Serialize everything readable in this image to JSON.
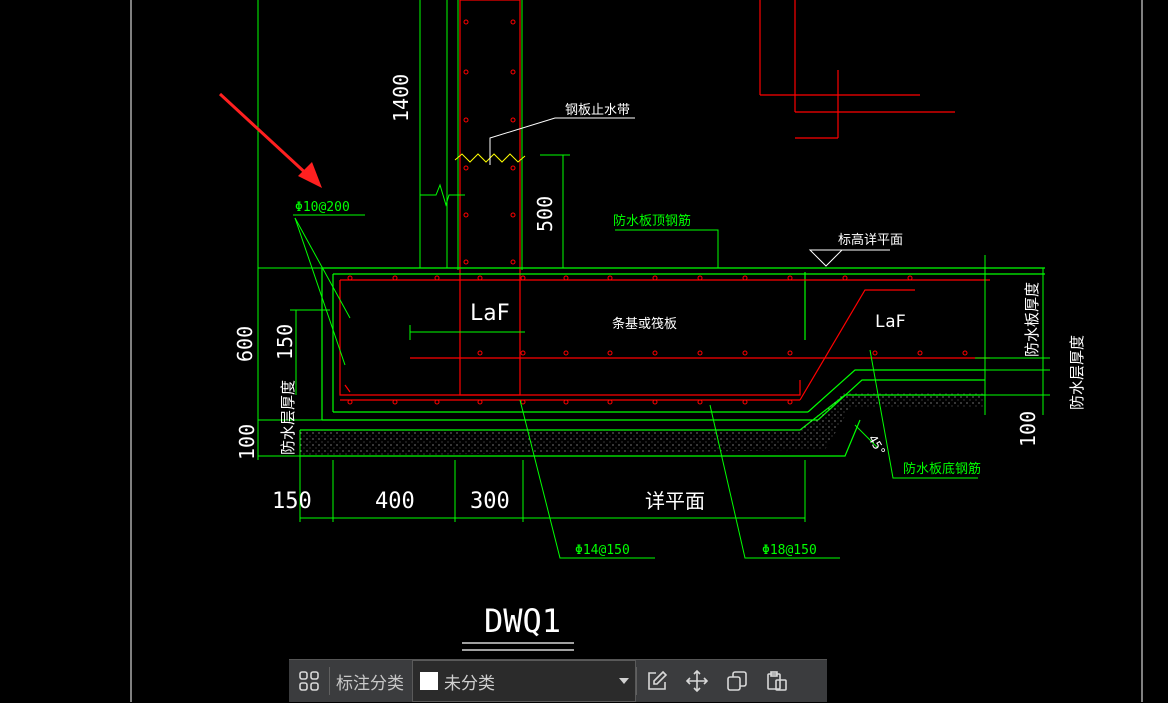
{
  "drawing": {
    "title": "DWQ1",
    "labels": {
      "rebar_top_left": "Φ10@200",
      "steel_waterstop": "钢板止水带",
      "waterproof_top_rebar": "防水板顶钢筋",
      "elevation_ref": "标高详平面",
      "laf_left": "LaF",
      "laf_right": "LaF",
      "strip_base": "条基或筏板",
      "waterproof_thickness_right": "防水板厚度",
      "waterproof_layer_right": "防水层厚度",
      "waterproof_layer_left": "防水层厚度",
      "waterproof_bottom_rebar": "防水板底钢筋",
      "rebar_14": "Φ14@150",
      "rebar_18": "Φ18@150",
      "detail_plan": "详平面",
      "angle": "45°"
    },
    "dims": {
      "h1400": "1400",
      "h500": "500",
      "h600": "600",
      "h150": "150",
      "h100_left": "100",
      "h100_right": "100",
      "w150": "150",
      "w400": "400",
      "w300": "300"
    }
  },
  "toolbar": {
    "category_label": "标注分类",
    "category_value": "未分类"
  },
  "colors": {
    "line_green": "#00ff00",
    "line_red": "#ff0000",
    "text_white": "#ffffff",
    "arrow_red": "#ff2020",
    "toolbar_bg": "#3b3c3e"
  }
}
